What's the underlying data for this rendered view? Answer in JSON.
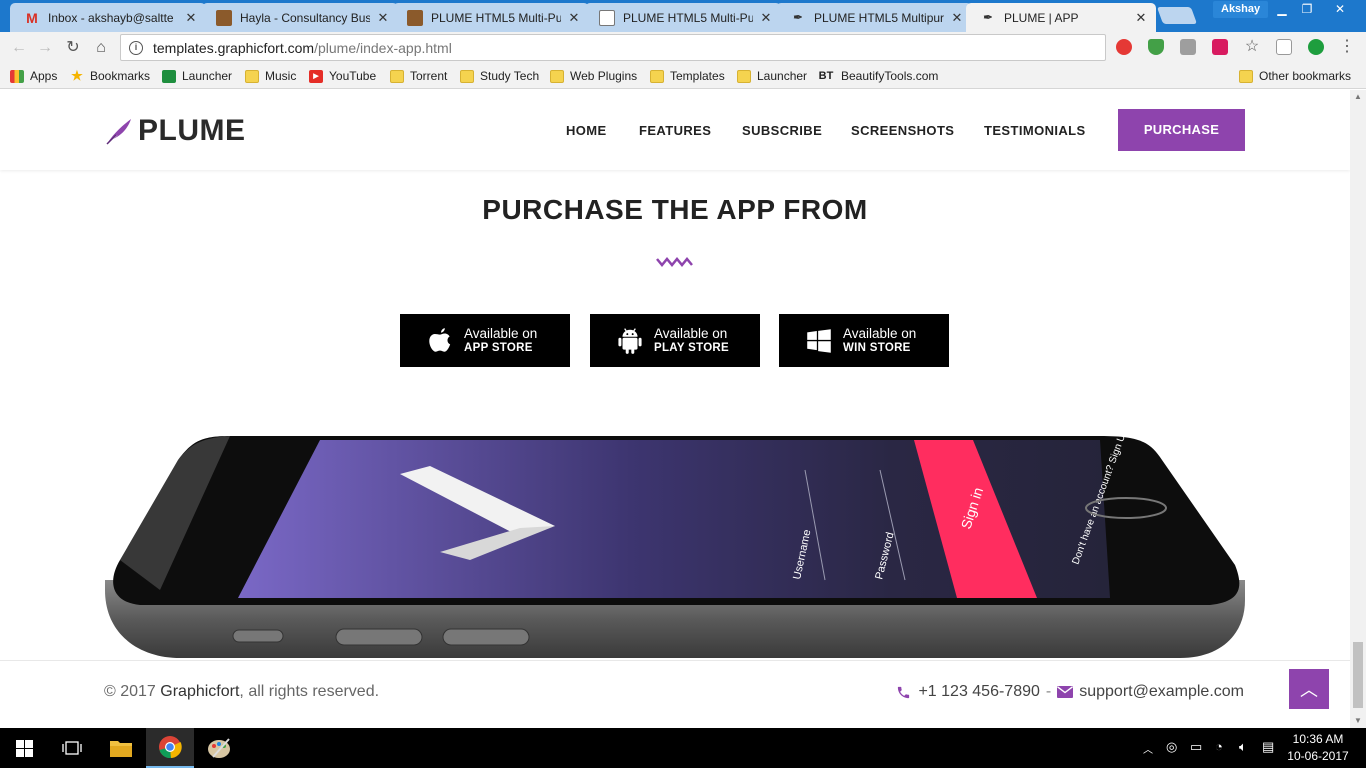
{
  "browser": {
    "tabs": [
      {
        "title": "Inbox - akshayb@saltte",
        "favicon": "gmail-icon",
        "active": false
      },
      {
        "title": "Hayla - Consultancy Bus",
        "favicon": "theme-icon",
        "active": false
      },
      {
        "title": "PLUME HTML5 Multi-Pu",
        "favicon": "theme-icon",
        "active": false
      },
      {
        "title": "PLUME HTML5 Multi-Pu",
        "favicon": "document-icon",
        "active": false
      },
      {
        "title": "PLUME HTML5 Multipur",
        "favicon": "feather-icon",
        "active": false
      },
      {
        "title": "PLUME | APP",
        "favicon": "feather-icon",
        "active": true
      }
    ],
    "profile_name": "Akshay",
    "url_host": "templates.graphicfort.com",
    "url_path": "/plume/index-app.html",
    "bookmarks": [
      {
        "label": "Apps",
        "icon": "apps-grid-icon"
      },
      {
        "label": "Bookmarks",
        "icon": "star-icon"
      },
      {
        "label": "Launcher",
        "icon": "sheet-icon"
      },
      {
        "label": "Music",
        "icon": "folder-icon"
      },
      {
        "label": "YouTube",
        "icon": "youtube-icon"
      },
      {
        "label": "Torrent",
        "icon": "folder-icon"
      },
      {
        "label": "Study Tech",
        "icon": "folder-icon"
      },
      {
        "label": "Web Plugins",
        "icon": "folder-icon"
      },
      {
        "label": "Templates",
        "icon": "folder-icon"
      },
      {
        "label": "Launcher",
        "icon": "folder-icon"
      },
      {
        "label": "BeautifyTools.com",
        "icon": "bt-icon"
      }
    ],
    "other_bookmarks": "Other bookmarks"
  },
  "site": {
    "logo_text": "PLUME",
    "nav": [
      "HOME",
      "FEATURES",
      "SUBSCRIBE",
      "SCREENSHOTS",
      "TESTIMONIALS"
    ],
    "purchase_label": "PURCHASE",
    "section_title": "PURCHASE THE APP FROM",
    "stores": [
      {
        "line1": "Available on",
        "line2": "APP STORE",
        "icon": "apple-icon"
      },
      {
        "line1": "Available on",
        "line2": "PLAY STORE",
        "icon": "android-icon"
      },
      {
        "line1": "Available on",
        "line2": "WIN STORE",
        "icon": "windows-icon"
      }
    ],
    "phone_screen": {
      "username_label": "Username",
      "password_label": "Password",
      "signin_label": "Sign in",
      "signup_text": "Don't have an account? Sign Up"
    },
    "footer": {
      "copyright_prefix": "© 2017",
      "company": "Graphicfort",
      "copyright_suffix": ", all rights reserved.",
      "phone": "+1 123 456-7890",
      "separator": "-",
      "email": "support@example.com"
    }
  },
  "taskbar": {
    "time": "10:36 AM",
    "date": "10-06-2017"
  },
  "colors": {
    "accent": "#8e44ad",
    "signin": "#ff2d5f",
    "chrome_blue": "#1d78cc"
  }
}
